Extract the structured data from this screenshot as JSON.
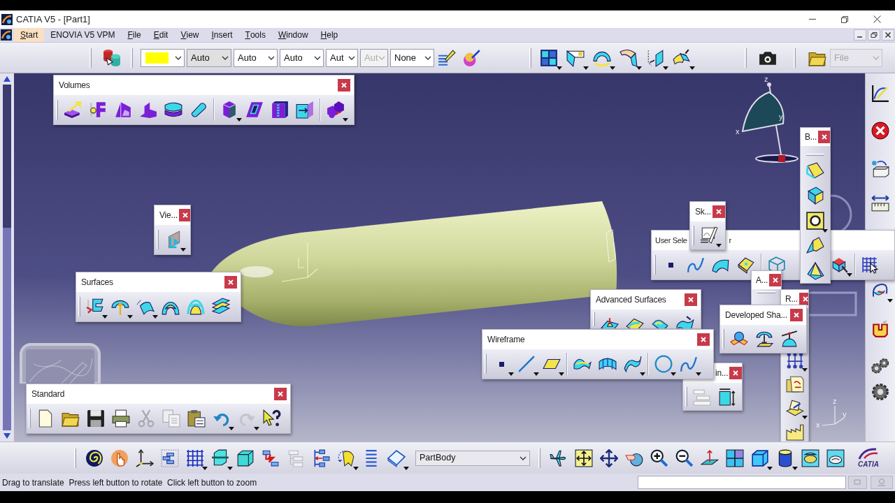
{
  "window": {
    "title": "CATIA V5 - [Part1]"
  },
  "menu_bar": {
    "items": [
      {
        "label": "Start",
        "selected": true,
        "mnemonic": true
      },
      {
        "label": "ENOVIA V5 VPM",
        "selected": false,
        "mnemonic": false
      },
      {
        "label": "File",
        "selected": false,
        "mnemonic": true
      },
      {
        "label": "Edit",
        "selected": false,
        "mnemonic": true
      },
      {
        "label": "View",
        "selected": false,
        "mnemonic": true
      },
      {
        "label": "Insert",
        "selected": false,
        "mnemonic": true
      },
      {
        "label": "Tools",
        "selected": false,
        "mnemonic": true
      },
      {
        "label": "Window",
        "selected": false,
        "mnemonic": true
      },
      {
        "label": "Help",
        "selected": false,
        "mnemonic": true
      }
    ]
  },
  "graphic_properties_toolbar": {
    "fields": [
      {
        "kind": "swatch",
        "color": "#ffff00"
      },
      {
        "kind": "select",
        "value": "Auto",
        "editable": false,
        "disabled": false
      },
      {
        "kind": "select",
        "value": "Auto",
        "editable": true,
        "disabled": false
      },
      {
        "kind": "select",
        "value": "Auto",
        "editable": true,
        "disabled": false
      },
      {
        "kind": "select",
        "value": "Aut",
        "editable": true,
        "disabled": false
      },
      {
        "kind": "select",
        "value": "Aut",
        "editable": true,
        "disabled": true
      },
      {
        "kind": "select",
        "value": "None",
        "editable": true,
        "disabled": false
      }
    ]
  },
  "file_selector": {
    "value": "File",
    "disabled": true
  },
  "floating_toolbars": [
    {
      "title": "Volumes"
    },
    {
      "title": "B..."
    },
    {
      "title": "Sk..."
    },
    {
      "title": "Vie..."
    },
    {
      "title": "User Sele",
      "title_end": "r"
    },
    {
      "title": "A..."
    },
    {
      "title": "Surfaces"
    },
    {
      "title": "Advanced Surfaces"
    },
    {
      "title": "R..."
    },
    {
      "title": "Developed Sha..."
    },
    {
      "title": "Wireframe"
    },
    {
      "title": "in..."
    },
    {
      "title": "Standard"
    }
  ],
  "compass": {
    "labels": [
      "z",
      "x",
      "y"
    ]
  },
  "corner_axis": {
    "labels": [
      "z",
      "x",
      "y"
    ]
  },
  "body_selector": {
    "value": "PartBody"
  },
  "logo": {
    "text": "CATIA"
  },
  "status_bar": {
    "message": "Drag to translate  Press left button to rotate  Click left button to zoom"
  }
}
